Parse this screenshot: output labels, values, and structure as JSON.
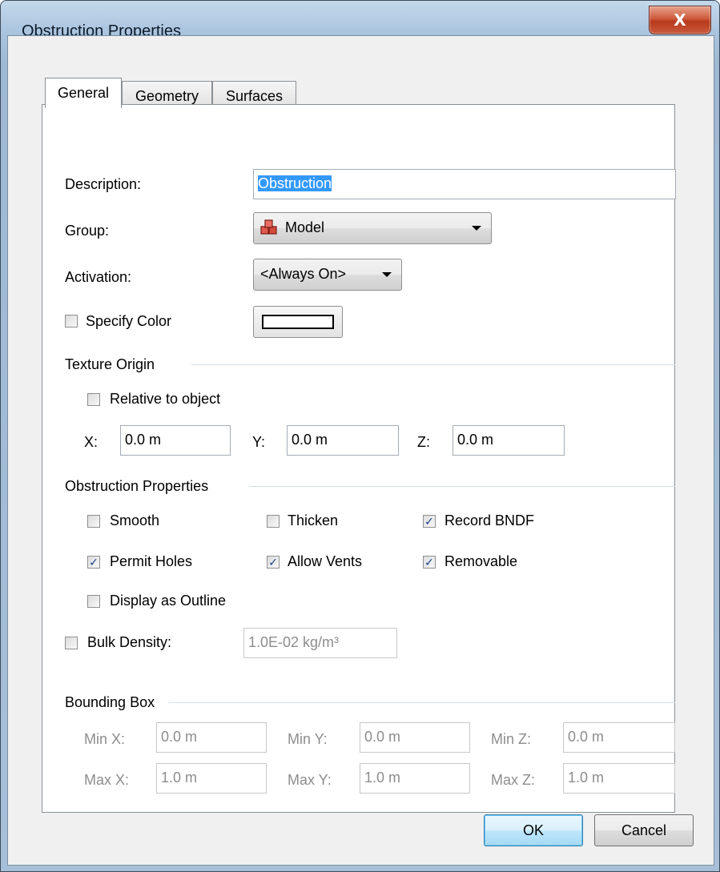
{
  "window": {
    "title": "Obstruction Properties",
    "close_glyph": "X"
  },
  "tabs": [
    {
      "label": "General",
      "active": true
    },
    {
      "label": "Geometry",
      "active": false
    },
    {
      "label": "Surfaces",
      "active": false
    }
  ],
  "general": {
    "description_label": "Description:",
    "description_value": "Obstruction",
    "group_label": "Group:",
    "group_value": "Model",
    "group_icon": "model-cubes-icon",
    "activation_label": "Activation:",
    "activation_value": "<Always On>",
    "specify_color_label": "Specify Color",
    "specify_color_checked": false,
    "color_value": "#ffffff"
  },
  "texture_origin": {
    "heading": "Texture Origin",
    "relative_label": "Relative to object",
    "relative_checked": false,
    "x_label": "X:",
    "x_value": "0.0 m",
    "y_label": "Y:",
    "y_value": "0.0 m",
    "z_label": "Z:",
    "z_value": "0.0 m"
  },
  "obstruction_properties": {
    "heading": "Obstruction Properties",
    "smooth": {
      "label": "Smooth",
      "checked": false
    },
    "thicken": {
      "label": "Thicken",
      "checked": false
    },
    "record_bndf": {
      "label": "Record BNDF",
      "checked": true
    },
    "permit_holes": {
      "label": "Permit Holes",
      "checked": true
    },
    "allow_vents": {
      "label": "Allow Vents",
      "checked": true
    },
    "removable": {
      "label": "Removable",
      "checked": true
    },
    "display_outline": {
      "label": "Display as Outline",
      "checked": false
    },
    "bulk_density": {
      "label": "Bulk Density:",
      "checked": false,
      "value": "1.0E-02 kg/m³"
    }
  },
  "bounding_box": {
    "heading": "Bounding Box",
    "min_x_label": "Min X:",
    "min_x": "0.0 m",
    "min_y_label": "Min Y:",
    "min_y": "0.0 m",
    "min_z_label": "Min Z:",
    "min_z": "0.0 m",
    "max_x_label": "Max X:",
    "max_x": "1.0 m",
    "max_y_label": "Max Y:",
    "max_y": "1.0 m",
    "max_z_label": "Max Z:",
    "max_z": "1.0 m"
  },
  "buttons": {
    "ok": "OK",
    "cancel": "Cancel"
  },
  "check_glyph": "✓"
}
